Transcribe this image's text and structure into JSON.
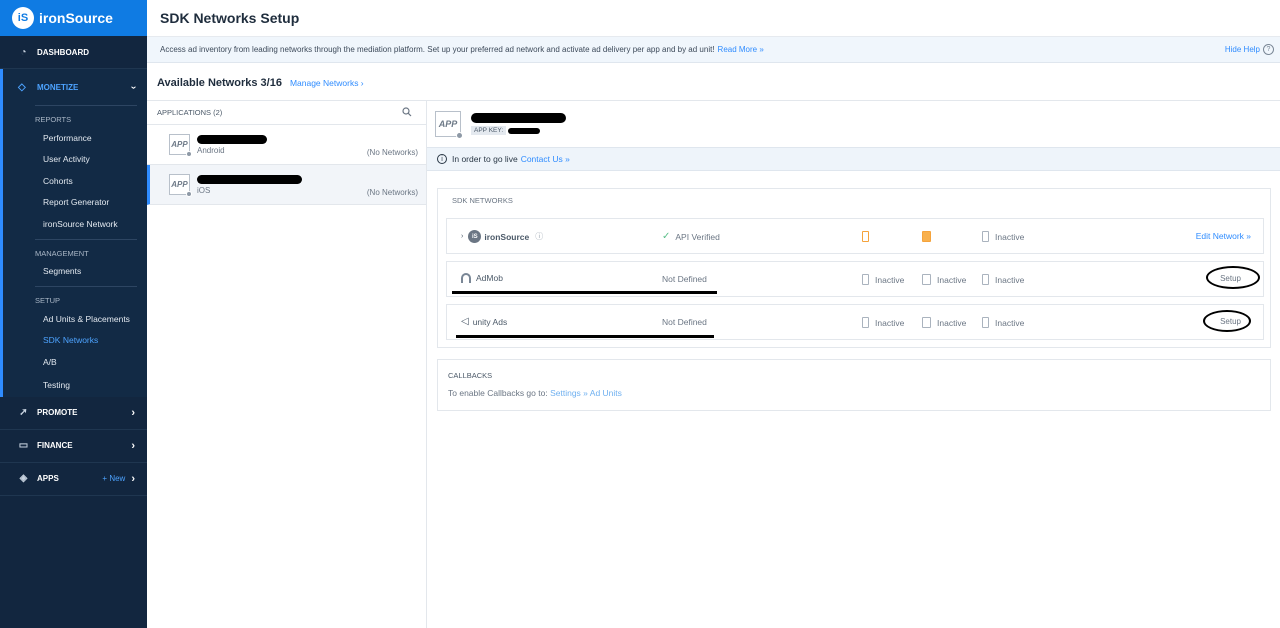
{
  "brand": {
    "logo_mark": "iS",
    "name": "ironSource"
  },
  "sidebar": {
    "dashboard": "DASHBOARD",
    "monetize": "MONETIZE",
    "reports_label": "REPORTS",
    "reports": [
      "Performance",
      "User Activity",
      "Cohorts",
      "Report Generator",
      "ironSource Network"
    ],
    "management_label": "MANAGEMENT",
    "management": [
      "Segments"
    ],
    "setup_label": "SETUP",
    "setup": [
      "Ad Units & Placements",
      "SDK Networks",
      "A/B",
      "Testing"
    ],
    "promote": "PROMOTE",
    "finance": "FINANCE",
    "apps": "APPS",
    "apps_new": "+ New"
  },
  "header": {
    "title": "SDK Networks Setup"
  },
  "info": {
    "text": "Access ad inventory from leading networks through the mediation platform. Set up your preferred ad network and activate ad delivery per app and by ad unit!",
    "read_more": "Read More »",
    "hide_help": "Hide Help",
    "help_glyph": "?"
  },
  "available": {
    "title": "Available Networks 3/16",
    "manage": "Manage Networks ›"
  },
  "applications": {
    "header": "APPLICATIONS (2)",
    "items": [
      {
        "icon": "APP",
        "platform": "Android",
        "status": "(No Networks)"
      },
      {
        "icon": "APP",
        "platform": "iOS",
        "status": "(No Networks)"
      }
    ]
  },
  "selected_app": {
    "icon": "APP",
    "key_label": "APP KEY:"
  },
  "live": {
    "glyph": "i",
    "text": "In order to go live",
    "contact": "Contact Us »"
  },
  "sdk": {
    "label": "SDK NETWORKS",
    "rows": [
      {
        "name": "ironSource",
        "status": "API Verified",
        "col1": "",
        "col2": "",
        "col3": "Inactive",
        "action": "Edit Network »"
      },
      {
        "name": "AdMob",
        "status": "Not Defined",
        "col1": "Inactive",
        "col2": "Inactive",
        "col3": "Inactive",
        "action": "Setup"
      },
      {
        "name": "unity Ads",
        "status": "Not Defined",
        "col1": "Inactive",
        "col2": "Inactive",
        "col3": "Inactive",
        "action": "Setup"
      }
    ]
  },
  "callbacks": {
    "title": "CALLBACKS",
    "text": "To enable Callbacks go to:",
    "link": "Settings » Ad Units"
  },
  "colors": {
    "sidebar": "#12263f",
    "accent": "#2f8cff",
    "logo_bar": "#0f7be3"
  }
}
